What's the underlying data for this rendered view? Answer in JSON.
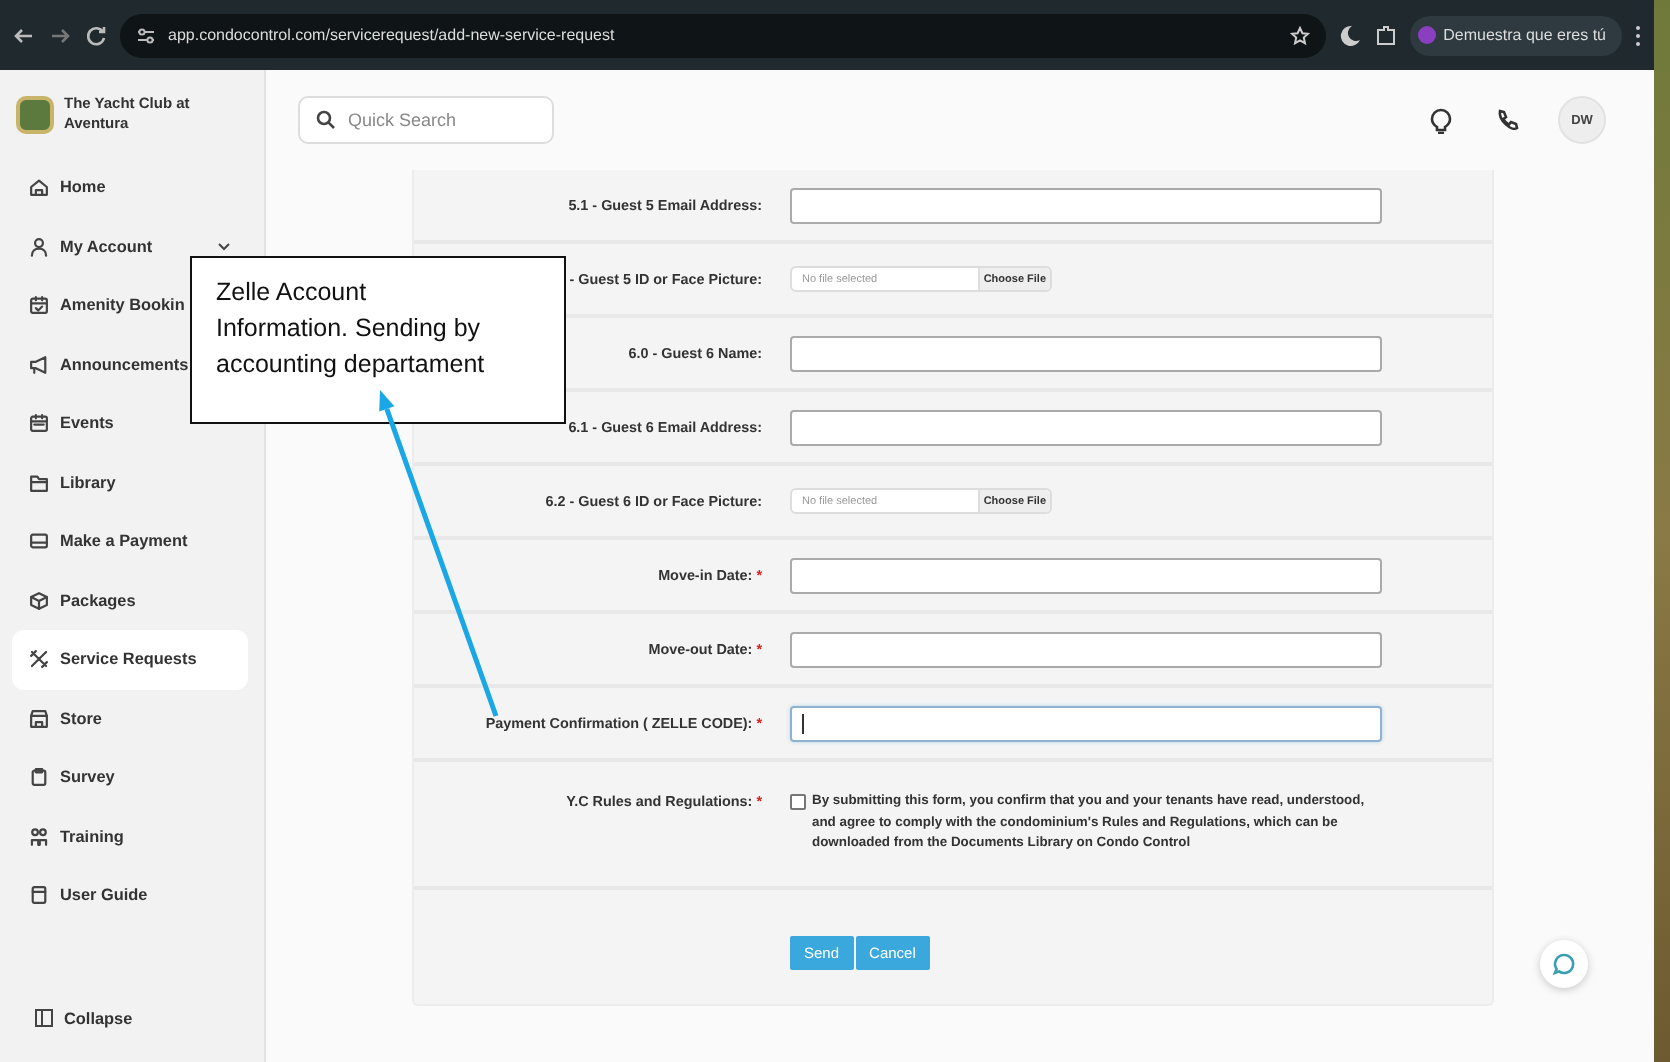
{
  "browser": {
    "url": "app.condocontrol.com/servicerequest/add-new-service-request",
    "profile": "Demuestra que eres tú"
  },
  "sidebar": {
    "title": "The Yacht Club at Aventura",
    "items": [
      {
        "label": "Home",
        "selected": false
      },
      {
        "label": "My Account",
        "selected": false,
        "expanded": false
      },
      {
        "label": "Amenity Bookin",
        "selected": false
      },
      {
        "label": "Announcements",
        "selected": false
      },
      {
        "label": "Events",
        "selected": false
      },
      {
        "label": "Library",
        "selected": false
      },
      {
        "label": "Make a Payment",
        "selected": false
      },
      {
        "label": "Packages",
        "selected": false
      },
      {
        "label": "Service Requests",
        "selected": true
      },
      {
        "label": "Store",
        "selected": false
      },
      {
        "label": "Survey",
        "selected": false
      },
      {
        "label": "Training",
        "selected": false
      },
      {
        "label": "User Guide",
        "selected": false
      }
    ],
    "collapse": "Collapse"
  },
  "header": {
    "search": {
      "placeholder": "Quick Search"
    },
    "avatar": "DW"
  },
  "form": {
    "fields": [
      {
        "kind": "text",
        "label": "5.1 - Guest 5 Email Address:",
        "focused": false
      },
      {
        "kind": "file",
        "label": "- Guest 5 ID or Face Picture:",
        "file_status": "No file selected",
        "button": "Choose File"
      },
      {
        "kind": "text",
        "label": "6.0 - Guest 6 Name:",
        "focused": false
      },
      {
        "kind": "text",
        "label": "6.1 - Guest 6 Email Address:",
        "focused": false
      },
      {
        "kind": "file",
        "label": "6.2 - Guest 6 ID or Face Picture:",
        "file_status": "No file selected",
        "button": "Choose File"
      },
      {
        "kind": "text",
        "label": "Move-in Date:",
        "required_mark": "*",
        "focused": false
      },
      {
        "kind": "text",
        "label": "Move-out Date:",
        "required_mark": "*",
        "focused": false
      },
      {
        "kind": "text",
        "label": "Payment Confirmation ( ZELLE CODE):",
        "required_mark": "*",
        "focused": true
      },
      {
        "kind": "checkbox",
        "label": "Y.C Rules and Regulations:",
        "required_mark": "*",
        "checked": false,
        "text": "By submitting this form, you confirm that you and your tenants have read, understood, and agree to comply with the condominium's Rules and Regulations, which can be downloaded from the Documents Library on Condo Control"
      }
    ],
    "buttons": [
      "Send",
      "Cancel"
    ]
  },
  "callout": {
    "text": "Zelle Account\nInformation. Sending by\naccounting departament"
  }
}
